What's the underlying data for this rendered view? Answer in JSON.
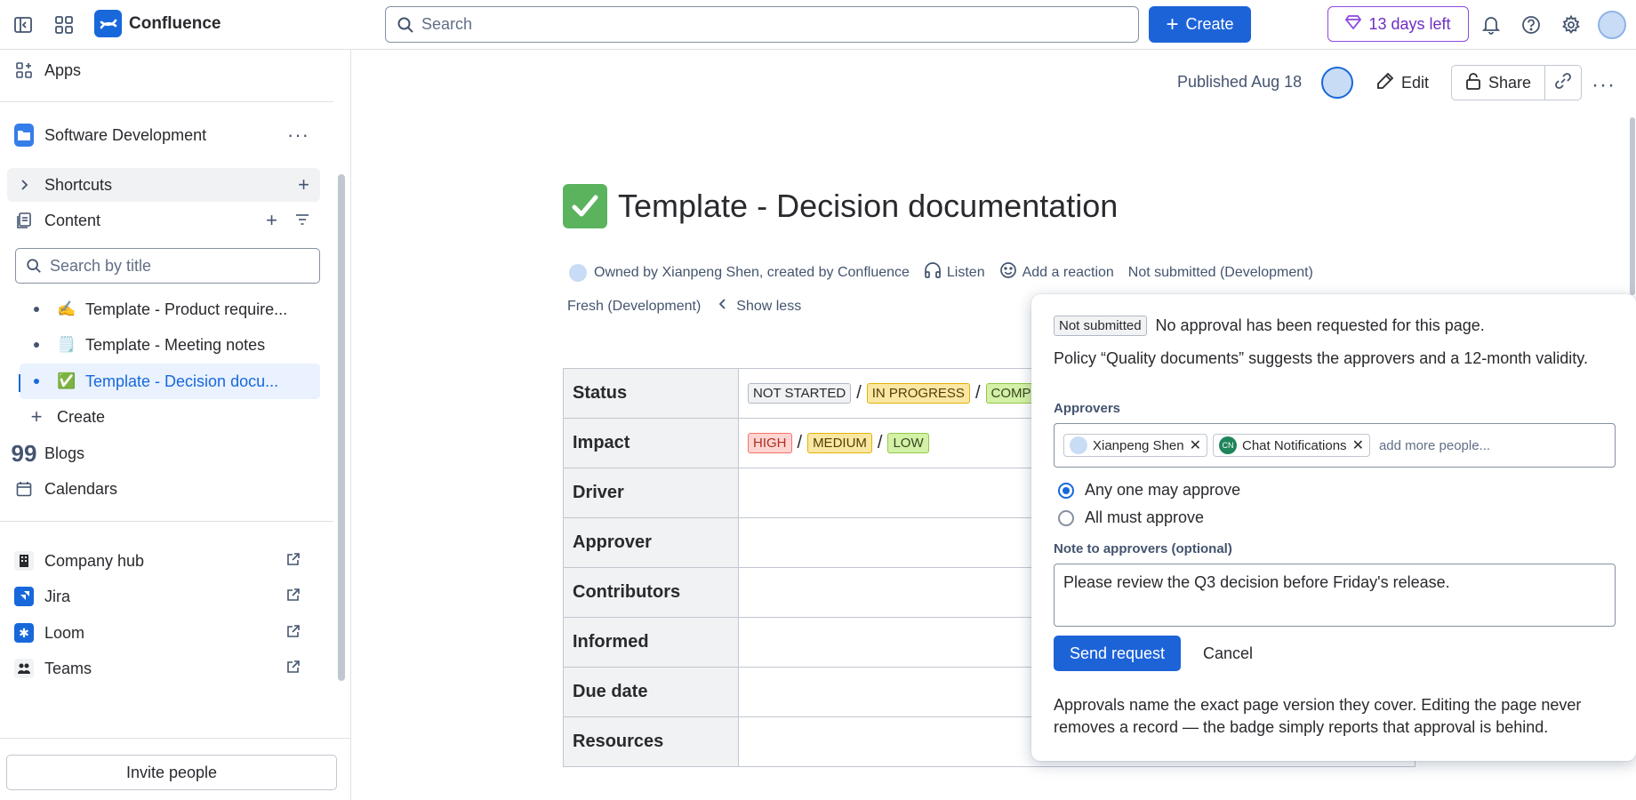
{
  "topbar": {
    "app_name": "Confluence",
    "search_placeholder": "Search",
    "create_label": "Create",
    "trial_label": "13 days left",
    "icons": [
      "sidebar-toggle-icon",
      "app-switcher-icon",
      "bell-icon",
      "help-icon",
      "gear-icon"
    ]
  },
  "sidebar": {
    "apps_label": "Apps",
    "space_name": "Software Development",
    "shortcuts_label": "Shortcuts",
    "content_label": "Content",
    "search_placeholder": "Search by title",
    "tree": [
      {
        "emoji": "✍️",
        "label": "Template - Product require..."
      },
      {
        "emoji": "🗒️",
        "label": "Template - Meeting notes"
      },
      {
        "emoji": "✅",
        "label": "Template - Decision docu...",
        "active": true
      }
    ],
    "create_label": "Create",
    "blogs_label": "Blogs",
    "calendars_label": "Calendars",
    "apps": [
      {
        "label": "Company hub",
        "color": "#292a2e"
      },
      {
        "label": "Jira",
        "color": "#1868db"
      },
      {
        "label": "Loom",
        "color": "#1868db"
      },
      {
        "label": "Teams",
        "color": "#292a2e"
      }
    ],
    "invite_label": "Invite people"
  },
  "header": {
    "published": "Published Aug 18",
    "edit_label": "Edit",
    "share_label": "Share"
  },
  "page": {
    "title": "Template - Decision documentation",
    "owned_by": "Owned by Xianpeng Shen, created by Confluence",
    "listen": "Listen",
    "add_reaction": "Add a reaction",
    "approval_status": "Not submitted (Development)",
    "freshness": "Fresh (Development)",
    "show_less": "Show less"
  },
  "table": {
    "rows": [
      "Status",
      "Impact",
      "Driver",
      "Approver",
      "Contributors",
      "Informed",
      "Due date",
      "Resources"
    ],
    "status_lozenges": [
      "NOT STARTED",
      "IN PROGRESS",
      "COMP"
    ],
    "impact_lozenges": [
      "HIGH",
      "MEDIUM",
      "LOW"
    ]
  },
  "popup": {
    "status_lozenge": "Not submitted",
    "status_text": "No approval has been requested for this page.",
    "policy_text": "Policy “Quality documents” suggests the approvers and a 12-month validity.",
    "approvers_label": "Approvers",
    "approvers": [
      "Xianpeng Shen",
      "Chat Notifications"
    ],
    "chat_avatar_initials": "CN",
    "add_more_placeholder": "add more people...",
    "options": [
      "Any one may approve",
      "All must approve"
    ],
    "selected_option": 0,
    "note_label": "Note to approvers (optional)",
    "note_value": "Please review the Q3 decision before Friday's release.",
    "send_label": "Send request",
    "cancel_label": "Cancel",
    "footer_text": "Approvals name the exact page version they cover. Editing the page never removes a record — the badge simply reports that approval is behind."
  }
}
